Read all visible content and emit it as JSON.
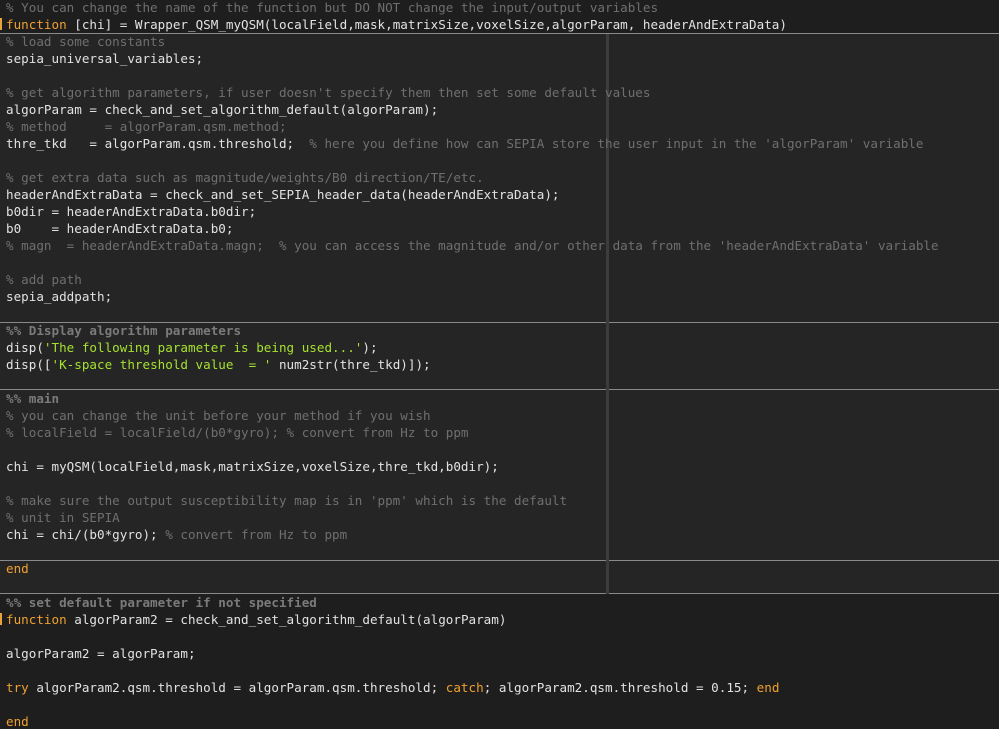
{
  "colors": {
    "background": "#1e1e1e",
    "cell_background": "#252525",
    "code_text": "#e2e2e2",
    "comment": "#6f6f6f",
    "keyword": "#f0a02f",
    "string": "#a6e22e",
    "cell_divider": "#8a8a8a",
    "right_margin": "#3c3c3c"
  },
  "lines": {
    "l01": {
      "text": "% You can change the name of the function but DO NOT change the input/output variables"
    },
    "l02": {
      "kw": "function",
      "text": " [chi] = Wrapper_QSM_myQSM(localField,mask,matrixSize,voxelSize,algorParam, headerAndExtraData)"
    },
    "l03": {
      "text": "% load some constants"
    },
    "l04": {
      "text": "sepia_universal_variables;"
    },
    "l06": {
      "text": "% get algorithm parameters, if user doesn't specify them then set some default values"
    },
    "l07": {
      "text": "algorParam = check_and_set_algorithm_default(algorParam);"
    },
    "l08": {
      "text": "% method     = algorParam.qsm.method;"
    },
    "l09": {
      "code": "thre_tkd   = algorParam.qsm.threshold;",
      "comment": "  % here you define how can SEPIA store the user input in the 'algorParam' variable"
    },
    "l11": {
      "text": "% get extra data such as magnitude/weights/B0 direction/TE/etc."
    },
    "l12": {
      "text": "headerAndExtraData = check_and_set_SEPIA_header_data(headerAndExtraData);"
    },
    "l13": {
      "text": "b0dir = headerAndExtraData.b0dir;"
    },
    "l14": {
      "text": "b0    = headerAndExtraData.b0;"
    },
    "l15": {
      "text": "% magn  = headerAndExtraData.magn;  % you can access the magnitude and/or other data from the 'headerAndExtraData' variable"
    },
    "l17": {
      "text": "% add path"
    },
    "l18": {
      "text": "sepia_addpath;"
    },
    "l20": {
      "text": "%% Display algorithm parameters"
    },
    "l21": {
      "pre": "disp(",
      "str": "'The following parameter is being used...'",
      "post": ");"
    },
    "l22": {
      "pre": "disp([",
      "str": "'K-space threshold value  = '",
      "post": " num2str(thre_tkd)]);"
    },
    "l24": {
      "text": "%% main"
    },
    "l25": {
      "text": "% you can change the unit before your method if you wish"
    },
    "l26": {
      "text": "% localField = localField/(b0*gyro); % convert from Hz to ppm"
    },
    "l28": {
      "text": "chi = myQSM(localField,mask,matrixSize,voxelSize,thre_tkd,b0dir);"
    },
    "l30": {
      "text": "% make sure the output susceptibility map is in 'ppm' which is the default"
    },
    "l31": {
      "text": "% unit in SEPIA"
    },
    "l32": {
      "code": "chi = chi/(b0*gyro);",
      "comment": " % convert from Hz to ppm"
    },
    "l34": {
      "kw": "end"
    },
    "l36": {
      "text": "%% set default parameter if not specified"
    },
    "l37": {
      "kw": "function",
      "text": " algorParam2 = check_and_set_algorithm_default(algorParam)"
    },
    "l39": {
      "text": "algorParam2 = algorParam;"
    },
    "l41": {
      "kw1": "try",
      "code1": " algorParam2.qsm.threshold = algorParam.qsm.threshold; ",
      "kw2": "catch",
      "code2": "; algorParam2.qsm.threshold = 0.15; ",
      "kw3": "end"
    },
    "l43": {
      "kw": "end"
    }
  }
}
